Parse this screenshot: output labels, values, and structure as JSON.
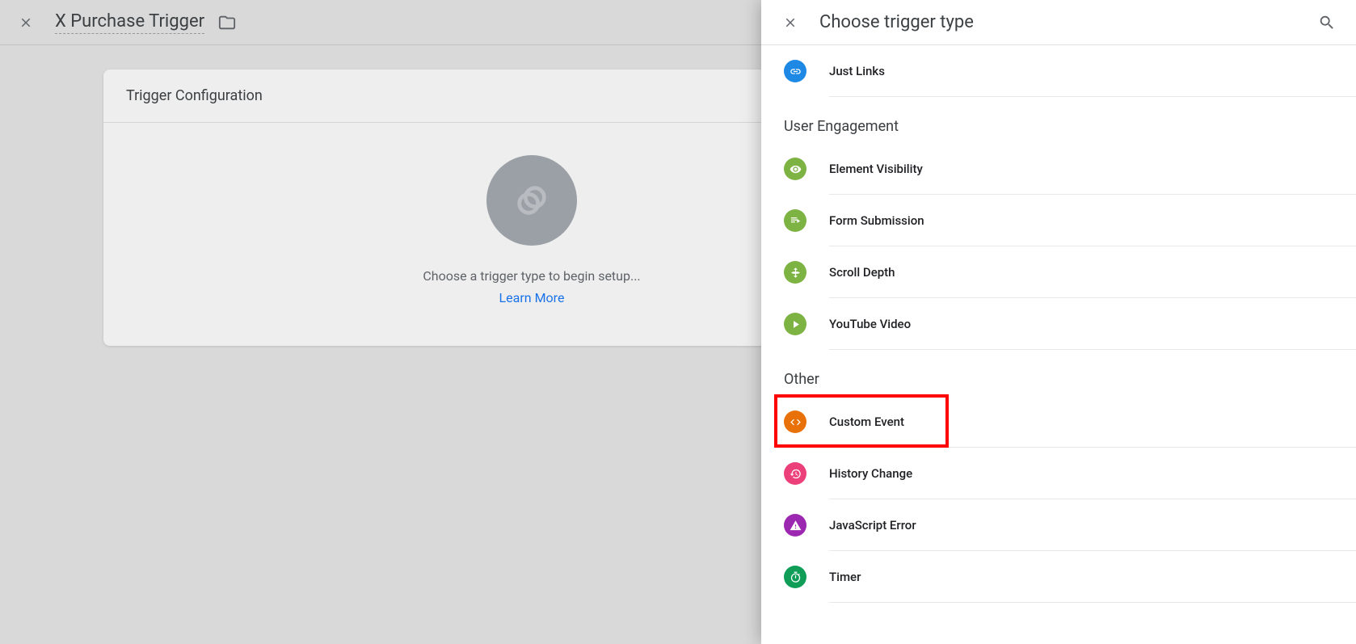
{
  "background": {
    "title": "X Purchase Trigger",
    "card_header": "Trigger Configuration",
    "placeholder_text": "Choose a trigger type to begin setup...",
    "learn_more": "Learn More"
  },
  "panel": {
    "title": "Choose trigger type",
    "sections": {
      "click": [
        {
          "label": "Just Links",
          "icon": "link-icon",
          "color": "bg-blue"
        }
      ],
      "user_engagement_header": "User Engagement",
      "user_engagement": [
        {
          "label": "Element Visibility",
          "icon": "eye-icon",
          "color": "bg-green"
        },
        {
          "label": "Form Submission",
          "icon": "form-icon",
          "color": "bg-green"
        },
        {
          "label": "Scroll Depth",
          "icon": "scroll-icon",
          "color": "bg-green"
        },
        {
          "label": "YouTube Video",
          "icon": "play-icon",
          "color": "bg-green"
        }
      ],
      "other_header": "Other",
      "other": [
        {
          "label": "Custom Event",
          "icon": "code-icon",
          "color": "bg-orange",
          "highlighted": true
        },
        {
          "label": "History Change",
          "icon": "history-icon",
          "color": "bg-pink"
        },
        {
          "label": "JavaScript Error",
          "icon": "warning-icon",
          "color": "bg-purple"
        },
        {
          "label": "Timer",
          "icon": "timer-icon",
          "color": "bg-dgreen"
        }
      ]
    }
  }
}
